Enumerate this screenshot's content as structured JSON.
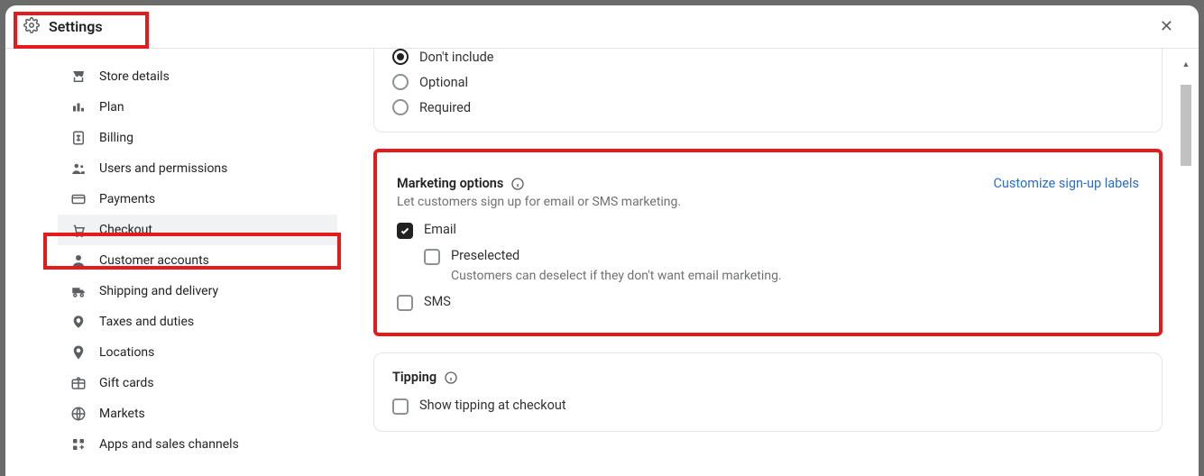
{
  "header": {
    "title": "Settings"
  },
  "sidebar": {
    "items": [
      {
        "label": "Store details",
        "icon": "store-icon"
      },
      {
        "label": "Plan",
        "icon": "plan-icon"
      },
      {
        "label": "Billing",
        "icon": "billing-icon"
      },
      {
        "label": "Users and permissions",
        "icon": "users-icon"
      },
      {
        "label": "Payments",
        "icon": "payments-icon"
      },
      {
        "label": "Checkout",
        "icon": "checkout-icon"
      },
      {
        "label": "Customer accounts",
        "icon": "customer-icon"
      },
      {
        "label": "Shipping and delivery",
        "icon": "shipping-icon"
      },
      {
        "label": "Taxes and duties",
        "icon": "taxes-icon"
      },
      {
        "label": "Locations",
        "icon": "locations-icon"
      },
      {
        "label": "Gift cards",
        "icon": "giftcards-icon"
      },
      {
        "label": "Markets",
        "icon": "markets-icon"
      },
      {
        "label": "Apps and sales channels",
        "icon": "apps-icon"
      }
    ],
    "active_index": 5
  },
  "main": {
    "radio_options": [
      {
        "label": "Don't include",
        "checked": true
      },
      {
        "label": "Optional",
        "checked": false
      },
      {
        "label": "Required",
        "checked": false
      }
    ],
    "marketing": {
      "title": "Marketing options",
      "desc": "Let customers sign up for email or SMS marketing.",
      "link": "Customize sign-up labels",
      "email": {
        "label": "Email",
        "checked": true
      },
      "preselected": {
        "label": "Preselected",
        "checked": false,
        "help": "Customers can deselect if they don't want email marketing."
      },
      "sms": {
        "label": "SMS",
        "checked": false
      }
    },
    "tipping": {
      "title": "Tipping",
      "show": {
        "label": "Show tipping at checkout",
        "checked": false
      }
    }
  }
}
